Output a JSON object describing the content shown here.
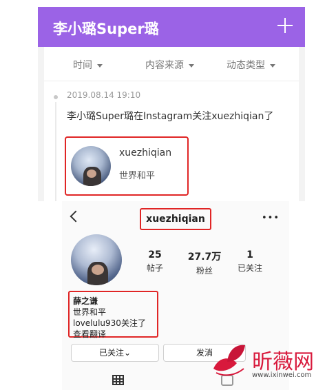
{
  "feed": {
    "app_title": "李小璐Super璐",
    "filters": [
      "时间",
      "内容来源",
      "动态类型"
    ],
    "time": "2019.08.14 19:10",
    "text": "李小璐Super璐在Instagram关注xuezhiqian了",
    "card": {
      "name": "xuezhiqian",
      "bio": "世界和平"
    }
  },
  "profile": {
    "handle": "xuezhiqian",
    "stats": [
      {
        "value": "25",
        "label": "帖子"
      },
      {
        "value": "27.7万",
        "label": "粉丝"
      },
      {
        "value": "1",
        "label": "已关注"
      }
    ],
    "bio": {
      "name": "薛之谦",
      "line1": "世界和平",
      "followed_by": "lovelulu930关注了",
      "translate": "查看翻译"
    },
    "follow_button": "已关注⌄",
    "message_button": "发消"
  },
  "watermark": {
    "text": "昕薇网",
    "url": "www.ixinwei.com"
  },
  "colors": {
    "app_purple": "#9b63e6",
    "highlight_red": "#e02525",
    "watermark_red": "#d8193c"
  }
}
